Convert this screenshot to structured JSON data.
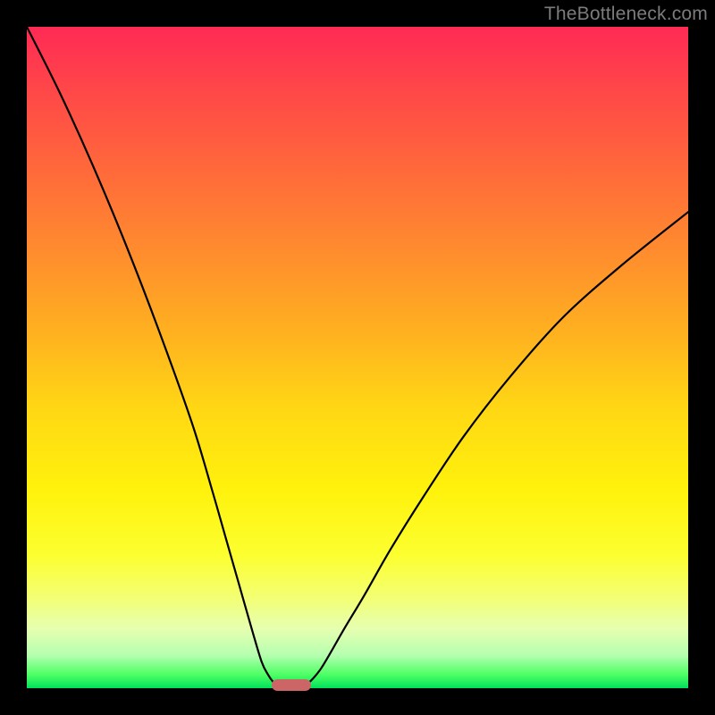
{
  "watermark": "TheBottleneck.com",
  "chart_data": {
    "type": "line",
    "title": "",
    "xlabel": "",
    "ylabel": "",
    "xlim": [
      0,
      100
    ],
    "ylim": [
      0,
      100
    ],
    "grid": false,
    "legend": false,
    "series": [
      {
        "name": "left-branch",
        "color": "#000000",
        "x": [
          0,
          5,
          10,
          15,
          20,
          25,
          28,
          30,
          32,
          34,
          35.5,
          36.5,
          37.2,
          37.8,
          38.2,
          38.5
        ],
        "values": [
          100,
          90,
          79,
          67,
          54,
          40,
          30,
          23,
          16,
          9,
          4,
          2,
          1,
          0.5,
          0.2,
          0.1
        ]
      },
      {
        "name": "right-branch",
        "color": "#000000",
        "x": [
          41.5,
          42,
          42.6,
          43.4,
          44.5,
          46,
          48,
          51,
          55,
          60,
          66,
          73,
          81,
          90,
          100
        ],
        "values": [
          0.1,
          0.3,
          0.8,
          1.6,
          3,
          5.5,
          9,
          14,
          21,
          29,
          38,
          47,
          56,
          64,
          72
        ]
      }
    ],
    "marker": {
      "name": "min-marker",
      "color": "#cc6666",
      "x_range": [
        37,
        43
      ],
      "y": 0.5,
      "height": 1.8
    }
  },
  "colors": {
    "frame": "#000000",
    "curve": "#000000",
    "marker": "#cc6666",
    "watermark": "#7c7c7c"
  }
}
